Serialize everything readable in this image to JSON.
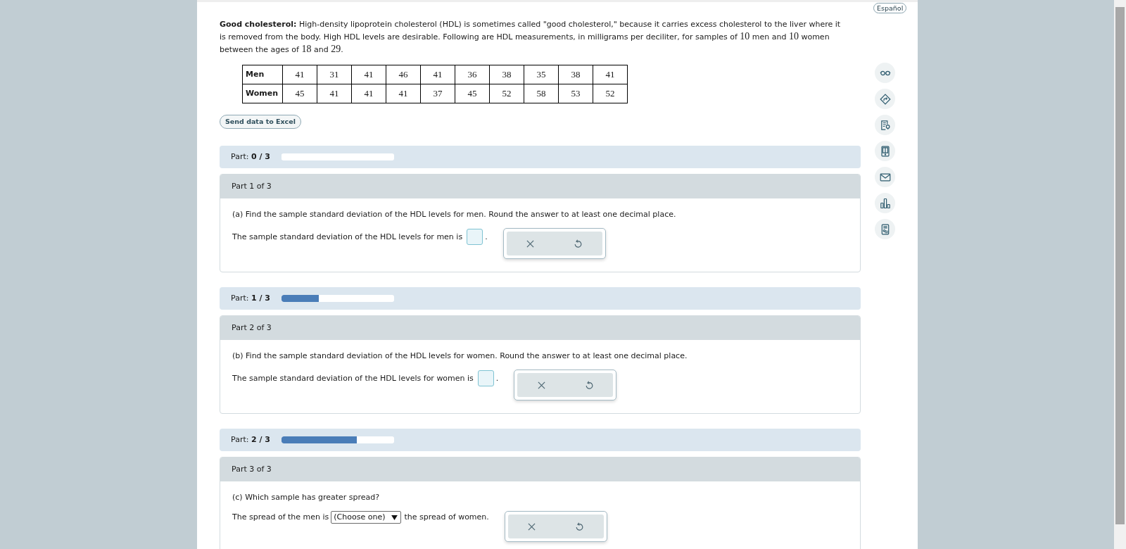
{
  "language_button": "Español",
  "intro": [
    {
      "kind": "text",
      "text": "**Good cholesterol:** High-density lipoprotein cholesterol (HDL) is sometimes called \"good cholesterol,\" because it carries excess cholesterol to the liver where it is removed from the body. High HDL levels are desirable. Following are HDL measurements, in milligrams per deciliter, for samples of "
    },
    {
      "kind": "math",
      "text": "10"
    },
    {
      "kind": "text",
      "text": " men and "
    },
    {
      "kind": "math",
      "text": "10"
    },
    {
      "kind": "text",
      "text": " women between the ages of "
    },
    {
      "kind": "math",
      "text": "18"
    },
    {
      "kind": "text",
      "text": " and "
    },
    {
      "kind": "math",
      "text": "29"
    },
    {
      "kind": "text",
      "text": "."
    }
  ],
  "table": {
    "rows": [
      {
        "label": "Men",
        "values": [
          "41",
          "31",
          "41",
          "46",
          "41",
          "36",
          "38",
          "35",
          "38",
          "41"
        ]
      },
      {
        "label": "Women",
        "values": [
          "45",
          "41",
          "41",
          "41",
          "37",
          "45",
          "52",
          "58",
          "53",
          "52"
        ]
      }
    ]
  },
  "excel_button": "Send data to Excel",
  "parts": [
    {
      "progress_label": "Part: **0 / 3**",
      "level": 0,
      "title": "Part 1 of 3",
      "question": "(a) Find the sample standard deviation of the HDL levels for men. Round the answer to at least one decimal place.",
      "answer": {
        "kind": "input",
        "prompt": "The sample standard deviation of the HDL levels for men is",
        "suffix": "."
      }
    },
    {
      "progress_label": "Part: **1 / 3**",
      "level": 0.333,
      "title": "Part 2 of 3",
      "question": "(b) Find the sample standard deviation of the HDL levels for women. Round the answer to at least one decimal place.",
      "answer": {
        "kind": "input",
        "prompt": "The sample standard deviation of the HDL levels for women is",
        "suffix": "."
      }
    },
    {
      "progress_label": "Part: **2 / 3**",
      "level": 0.667,
      "title": "Part 3 of 3",
      "question": "(c) Which sample has greater spread?",
      "answer": {
        "kind": "select",
        "prompt": "The spread of the men is",
        "choice": "(Choose one)",
        "suffix": "the spread of women."
      }
    }
  ]
}
